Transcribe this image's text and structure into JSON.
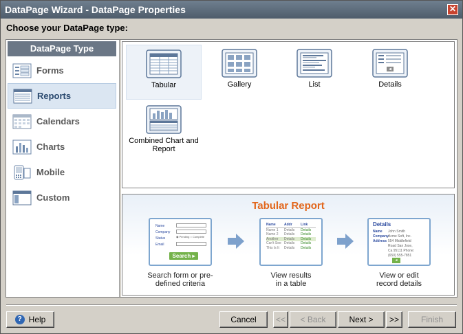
{
  "window": {
    "title": "DataPage Wizard - DataPage Properties",
    "close_glyph": "✕"
  },
  "prompt": "Choose your DataPage type:",
  "sidebar": {
    "header": "DataPage Type",
    "items": [
      {
        "label": "Forms",
        "icon": "forms-icon",
        "selected": false
      },
      {
        "label": "Reports",
        "icon": "reports-icon",
        "selected": true
      },
      {
        "label": "Calendars",
        "icon": "calendars-icon",
        "selected": false
      },
      {
        "label": "Charts",
        "icon": "charts-icon",
        "selected": false
      },
      {
        "label": "Mobile",
        "icon": "mobile-icon",
        "selected": false
      },
      {
        "label": "Custom",
        "icon": "custom-icon",
        "selected": false
      }
    ]
  },
  "types": [
    {
      "label": "Tabular",
      "icon": "tabular-icon",
      "selected": true
    },
    {
      "label": "Gallery",
      "icon": "gallery-icon",
      "selected": false
    },
    {
      "label": "List",
      "icon": "list-icon",
      "selected": false
    },
    {
      "label": "Details",
      "icon": "details-icon",
      "selected": false
    },
    {
      "label": "Combined Chart and Report",
      "icon": "combined-chart-report-icon",
      "selected": false
    }
  ],
  "preview": {
    "title": "Tabular Report",
    "search_form": {
      "fields": [
        "Name",
        "Company",
        "Status",
        "Email"
      ],
      "status_options": [
        "Pending",
        "Complete"
      ],
      "button": "Search"
    },
    "table": {
      "headers": [
        "Name",
        "Addr",
        "Link"
      ],
      "rows": [
        [
          "Name 1",
          "Details",
          "Details"
        ],
        [
          "Name 2",
          "Details",
          "Details"
        ],
        [
          "Another",
          "Details",
          "Details"
        ],
        [
          "Can't See",
          "Details",
          "Details"
        ],
        [
          "This Is It",
          "Details",
          "Details"
        ]
      ]
    },
    "details": {
      "title": "Details",
      "fields": [
        {
          "label": "Name",
          "value": "John Smith"
        },
        {
          "label": "Company",
          "value": "Acme Soft, Inc."
        },
        {
          "label": "Address",
          "value": "554 Middlefield Road San Jose, Ca 95111 Phone: (650) 555-7851"
        }
      ]
    },
    "captions": [
      "Search form or pre-defined criteria",
      "View results in a table",
      "View or edit record details"
    ]
  },
  "buttons": {
    "help": "Help",
    "cancel": "Cancel",
    "first": "<<",
    "back": "< Back",
    "next": "Next >",
    "last": ">>",
    "finish": "Finish"
  },
  "colors": {
    "accent_orange": "#e2661b",
    "sidebar_header": "#6b7786",
    "selection": "#dbe6f2"
  }
}
